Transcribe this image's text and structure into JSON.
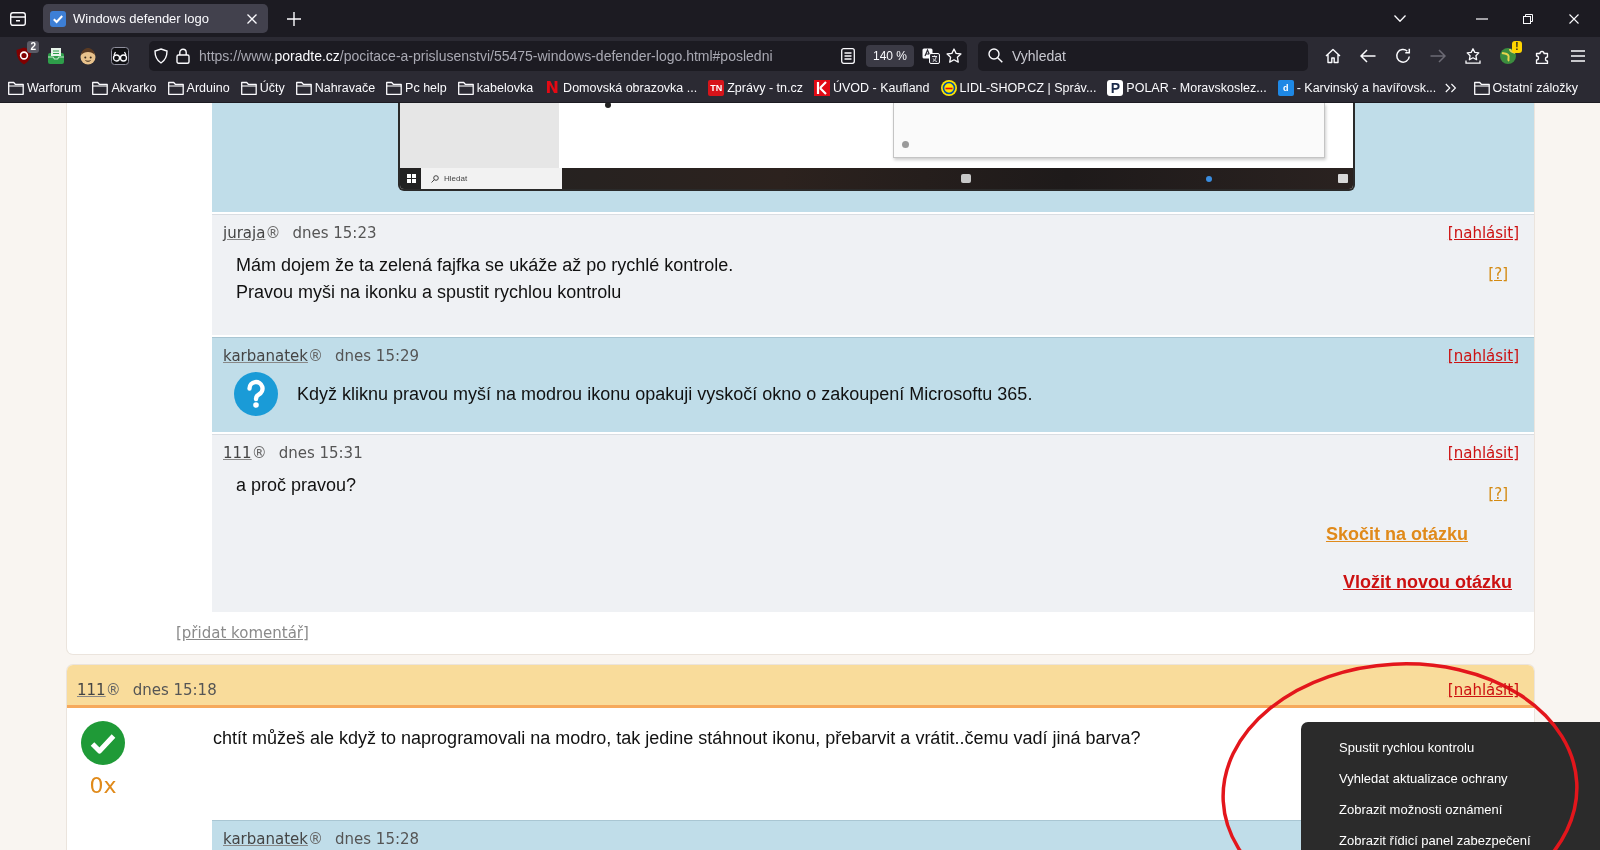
{
  "browser": {
    "tabs": [
      {
        "title": "Windows defender logo",
        "selected": true
      }
    ],
    "extension_badge": "2",
    "url": {
      "scheme": "https://www.",
      "domain": "poradte.cz",
      "path": "/pocitace-a-prislusenstvi/55475-windows-defender-logo.html#posledni"
    },
    "zoom": "140 %",
    "search": {
      "placeholder": "Vyhledat"
    },
    "nav_buttons": [
      {
        "kind": "home",
        "disabled": false
      },
      {
        "kind": "back",
        "disabled": false
      },
      {
        "kind": "reload",
        "disabled": false
      },
      {
        "kind": "forward",
        "disabled": true
      }
    ],
    "alert_badge": "!",
    "bookmarks": [
      {
        "label": "Warforum",
        "kind": "folder"
      },
      {
        "label": "Akvarko",
        "kind": "folder"
      },
      {
        "label": "Arduino",
        "kind": "folder"
      },
      {
        "label": "Účty",
        "kind": "folder"
      },
      {
        "label": "Nahravače",
        "kind": "folder"
      },
      {
        "label": "Pc help",
        "kind": "folder"
      },
      {
        "label": "kabelovka",
        "kind": "folder"
      },
      {
        "label": "Domovská obrazovka ...",
        "kind": "glyph",
        "logo_text": "N",
        "color": "#e50914"
      },
      {
        "label": "Zprávy - tn.cz",
        "kind": "tile",
        "logo_text": "TN",
        "color": "#d7141a"
      },
      {
        "label": "ÚVOD - Kaufland",
        "kind": "mark",
        "color": "#e10915"
      },
      {
        "label": "LIDL-SHOP.CZ | Správ...",
        "kind": "disc",
        "color": "#ffe500"
      },
      {
        "label": "POLAR - Moravskoslez...",
        "kind": "plate",
        "logo_text": "P",
        "color": "#1b2a4a"
      },
      {
        "label": "- Karvinský a havířovsk...",
        "kind": "tile",
        "logo_text": "d",
        "color": "#1e88e5"
      }
    ],
    "other_bookmarks": "Ostatní záložky"
  },
  "image_post": {
    "kind": "asker",
    "taskbar_search": "Hledat"
  },
  "comments": [
    {
      "kind": "helper",
      "author": "juraja",
      "author_mark": "®",
      "time": "dnes 15:23",
      "report": "[nahlásit]",
      "question": false,
      "text": "Mám dojem že ta zelená fajfka se ukáže až po rychlé kontrole.\nPravou myši na ikonku a spustit rychlou kontrolu",
      "help": "[?]"
    },
    {
      "kind": "asker",
      "author": "karbanatek",
      "author_mark": "®",
      "time": "dnes 15:29",
      "report": "[nahlásit]",
      "question": true,
      "text": "Když kliknu pravou myší na modrou ikonu opakuji vyskočí okno o zakoupení Microsoftu 365."
    },
    {
      "kind": "helper",
      "author": "111",
      "author_mark": "®",
      "time": "dnes 15:31",
      "report": "[nahlásit]",
      "question": false,
      "text": "a proč pravou?",
      "help": "[?]",
      "links": [
        {
          "label": "Skočit na otázku",
          "kind": "jump"
        },
        {
          "label": "Vložit novou otázku",
          "kind": "new"
        }
      ]
    }
  ],
  "add_comment": "[přidat komentář]",
  "answer": {
    "author": "111",
    "author_mark": "®",
    "time": "dnes 15:18",
    "report": "[nahlásit]",
    "accepted": true,
    "text": "chtít můžeš ale když to naprogramovali na modro, tak jedine stáhnout ikonu, přebarvit a vrátit..čemu vadí jiná barva?",
    "score": "0x",
    "replies": [
      {
        "kind": "asker",
        "author": "karbanatek",
        "author_mark": "®",
        "time": "dnes 15:28"
      }
    ]
  },
  "context_menu": {
    "items": [
      "Spustit rychlou kontrolu",
      "Vyhledat aktualizace ochrany",
      "Zobrazit možnosti oznámení",
      "Zobrazit řídicí panel zabezpečení"
    ]
  }
}
